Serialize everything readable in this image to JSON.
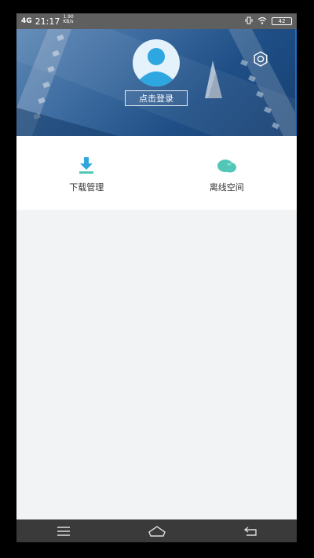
{
  "status_bar": {
    "signal_label": "4G",
    "time": "21:17",
    "net_speed": "1.90\nKB/s",
    "battery": "42"
  },
  "header": {
    "login_label": "点击登录"
  },
  "menu": [
    {
      "label": "下载管理",
      "icon": "download-icon"
    },
    {
      "label": "离线空间",
      "icon": "cloud-icon"
    }
  ],
  "nav": [
    "menu-icon",
    "home-icon",
    "back-icon"
  ],
  "colors": {
    "accent": "#2ea7e0",
    "teal": "#52c7b8",
    "header_dark": "#1f4f86"
  }
}
